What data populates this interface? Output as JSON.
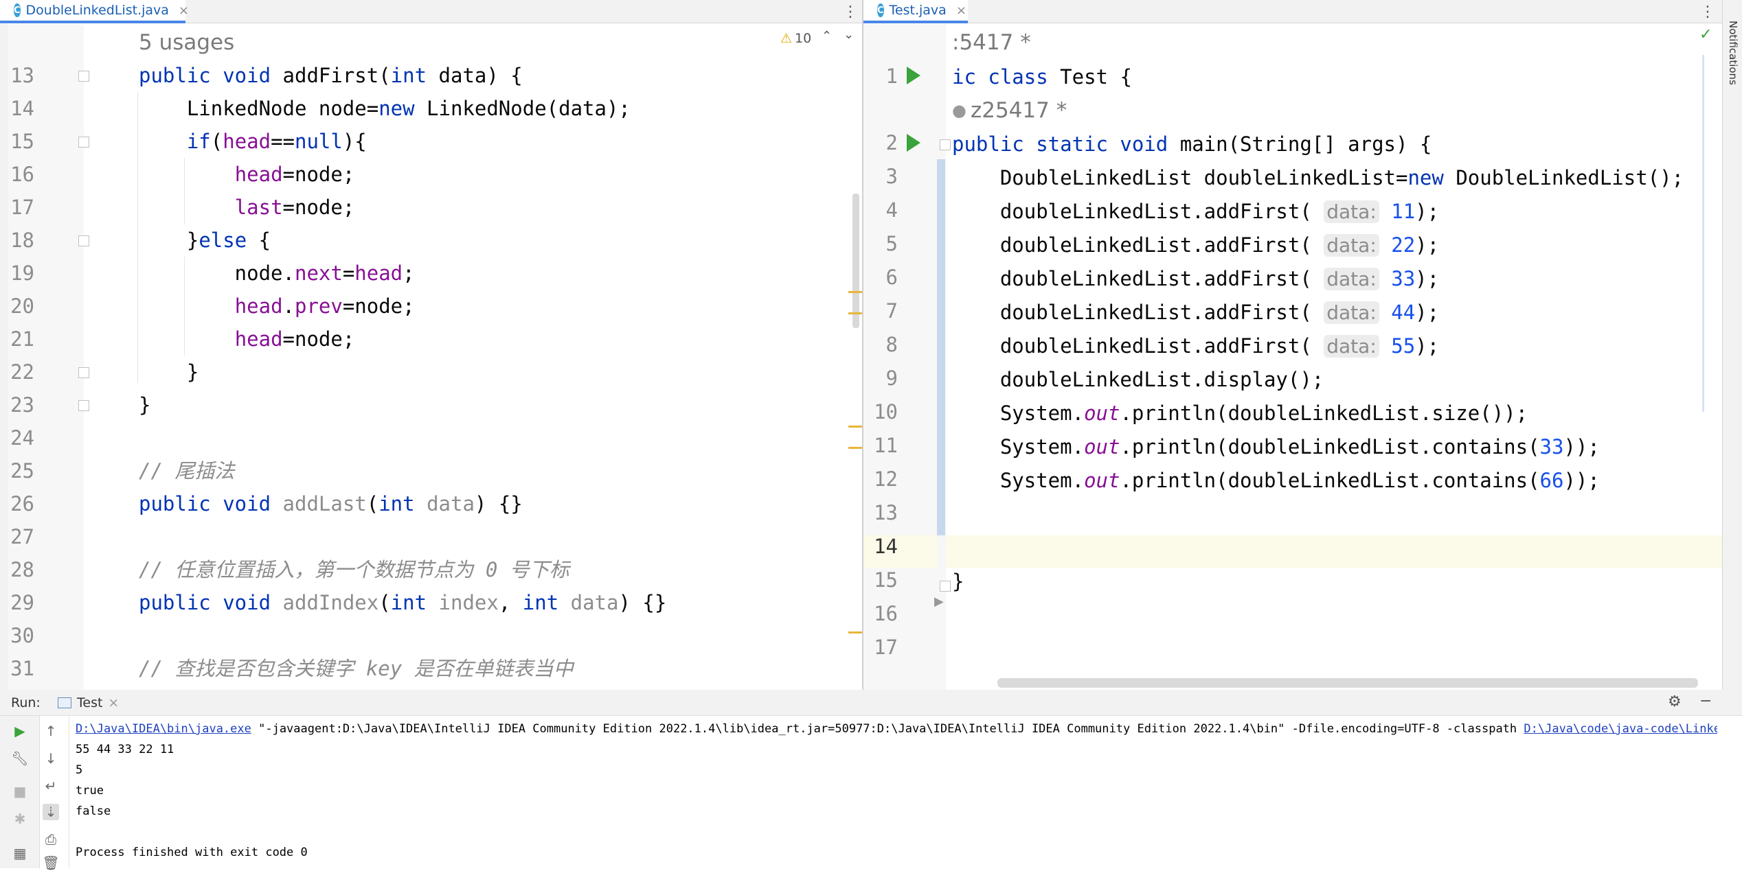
{
  "left_editor": {
    "tab_label": "DoubleLinkedList.java",
    "tab_icon": "C",
    "usages_hint": "5 usages",
    "warnings_count": "10",
    "line_numbers": [
      "13",
      "14",
      "15",
      "16",
      "17",
      "18",
      "19",
      "20",
      "21",
      "22",
      "23",
      "24",
      "25",
      "26",
      "27",
      "28",
      "29",
      "30",
      "31"
    ]
  },
  "right_editor": {
    "tab_label": "Test.java",
    "tab_icon": "C",
    "author_line_top": ":5417 *",
    "author_line": "z25417 *",
    "line_numbers": [
      "1",
      "2",
      "3",
      "4",
      "5",
      "6",
      "7",
      "8",
      "9",
      "10",
      "11",
      "12",
      "13",
      "14",
      "15",
      "16",
      "17"
    ]
  },
  "sidebar": {
    "notifications_label": "Notifications"
  },
  "run_panel": {
    "run_label": "Run:",
    "tab_label": "Test",
    "command_exe": "D:\\Java\\IDEA\\bin\\java.exe",
    "command_args": " \"-javaagent:D:\\Java\\IDEA\\IntelliJ IDEA Community Edition 2022.1.4\\lib\\idea_rt.jar=50977:D:\\Java\\IDEA\\IntelliJ IDEA Community Edition 2022.1.4\\bin\" -Dfile.encoding=UTF-8 -classpath ",
    "command_classpath": "D:\\Java\\code\\java-code\\LinkedList",
    "output_lines": [
      "55 44 33 22 11",
      "5",
      "true",
      "false",
      "",
      "Process finished with exit code 0"
    ]
  }
}
